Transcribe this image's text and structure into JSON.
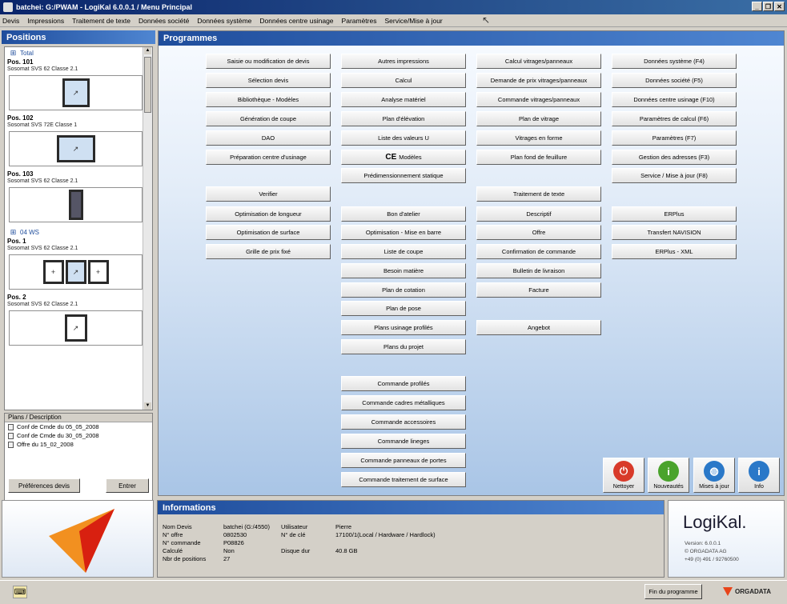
{
  "window": {
    "title": "batchei: G:/PWAM - LogiKal 6.0.0.1 / Menu Principal"
  },
  "menu": [
    "Devis",
    "Impressions",
    "Traitement de texte",
    "Données société",
    "Données système",
    "Données centre usinage",
    "Paramètres",
    "Service/Mise à jour"
  ],
  "left": {
    "header": "Positions",
    "groups": [
      {
        "label": "Total"
      },
      {
        "label": "04 WS"
      }
    ],
    "positions": [
      {
        "title": "Pos. 101",
        "sub": "Sosomat SVS 62 Classe 2.1"
      },
      {
        "title": "Pos. 102",
        "sub": "Sosomat SVS 72E Classe 1"
      },
      {
        "title": "Pos. 103",
        "sub": "Sosomat SVS 62 Classe 2.1"
      },
      {
        "title": "Pos. 1",
        "sub": "Sosomat SVS 62 Classe 2.1"
      },
      {
        "title": "Pos. 2",
        "sub": "Sosomat SVS 62 Classe 2.1"
      }
    ],
    "plans_header": "Plans / Description",
    "plans": [
      "Conf de Cmde du 05_05_2008",
      "Conf de Cmde du 30_05_2008",
      "Offre du 15_02_2008"
    ],
    "btn_prefs": "Préférences devis",
    "btn_enter": "Entrer"
  },
  "programmes": {
    "header": "Programmes",
    "col1": [
      "Saisie ou modification de devis",
      "Sélection devis",
      "Bibliothèque - Modèles",
      "Génération de coupe",
      "DAO",
      "Préparation centre d'usinage",
      "Verifier",
      "Optimisation de longueur",
      "Optimisation de surface",
      "Grille de prix fixé"
    ],
    "col2": [
      "Autres impressions",
      "Calcul",
      "Analyse matériel",
      "Plan d'élévation",
      "Liste des valeurs U",
      "Modèles",
      "Prédimensionnement statique",
      "Bon d'atelier",
      "Optimisation - Mise en barre",
      "Liste de coupe",
      "Besoin matière",
      "Plan de cotation",
      "Plan de pose",
      "Plans usinage profilés",
      "Plans du projet",
      "Commande profilés",
      "Commande cadres métalliques",
      "Commande accessoires",
      "Commande lineges",
      "Commande panneaux de portes",
      "Commande traitement de surface"
    ],
    "col2_ce": "CE",
    "col3": [
      "Calcul vitrages/panneaux",
      "Demande de prix vitrages/panneaux",
      "Commande vitrages/panneaux",
      "Plan de vitrage",
      "Vitrages en forme",
      "Plan fond de feuillure",
      "Traitement de texte",
      "Descriptif",
      "Offre",
      "Confirmation de commande",
      "Bulletin de livraison",
      "Facture",
      "Angebot"
    ],
    "col4": [
      "Données système (F4)",
      "Données société (F5)",
      "Données centre usinage (F10)",
      "Paramètres de calcul (F6)",
      "Paramètres (F7)",
      "Gestion des adresses (F3)",
      "Service / Mise à jour (F8)",
      "ERPlus",
      "Transfert NAVISION",
      "ERPlus - XML"
    ],
    "big_buttons": [
      {
        "label": "Nettoyer",
        "icon": "power-icon",
        "color": "#d83a2a"
      },
      {
        "label": "Nouveautés",
        "icon": "info-icon",
        "color": "#4aa32c"
      },
      {
        "label": "Mises à jour",
        "icon": "globe-icon",
        "color": "#2a78c8"
      },
      {
        "label": "Info",
        "icon": "info-icon",
        "color": "#2a78c8"
      }
    ]
  },
  "info": {
    "header": "Informations",
    "rows": [
      [
        "Nom Devis",
        "batchei (G:/4550)",
        "Utilisateur",
        "Pierre"
      ],
      [
        "N° offre",
        "0802530",
        "N° de clé",
        "17100/1(Local / Hardware / Hardlock)"
      ],
      [
        "N° commande",
        "P08826",
        "",
        ""
      ],
      [
        "Calculé",
        "Non",
        "Disque dur",
        "40.8 GB"
      ],
      [
        "Nbr de positions",
        "27",
        "",
        ""
      ]
    ]
  },
  "brand": {
    "name": "LogiKal.",
    "line1": "Version: 6.0.0.1",
    "line2": "© ORGADATA AG",
    "line3": "+49 (0) 491 / 92760500"
  },
  "status": {
    "quit": "Fin du programme",
    "company": "ORGADATA"
  },
  "colors": {
    "title_bar": "#0a246a",
    "panel_header": "#1f4d9c",
    "mark_red": "#e04030",
    "mark_green": "#3aa040",
    "mark_yellow": "#e8c020",
    "mark_white": "#ffffff",
    "logo_orange": "#f29020",
    "logo_red": "#d82010"
  }
}
